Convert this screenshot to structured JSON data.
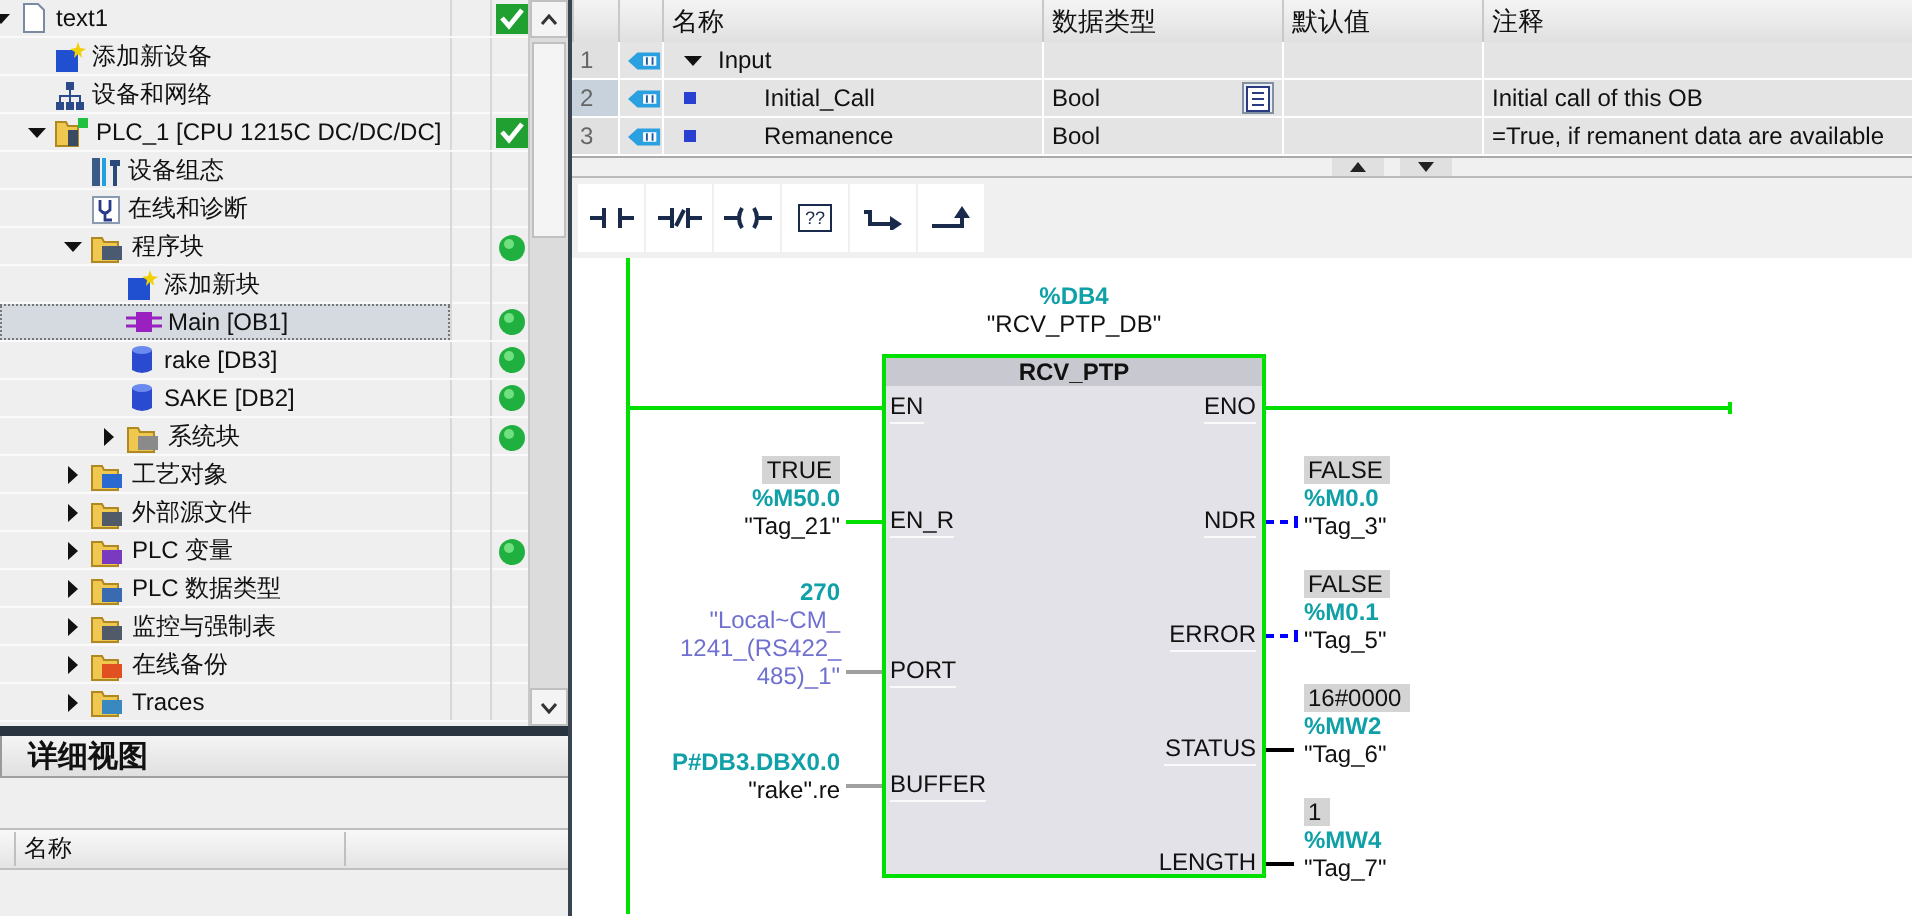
{
  "project_tree": {
    "items": [
      {
        "label": "text1",
        "kind": "project",
        "expanded": true,
        "selected": false,
        "status": {
          "kind": "check"
        },
        "children": [
          {
            "label": "添加新设备",
            "kind": "add-device",
            "selected": false
          },
          {
            "label": "设备和网络",
            "kind": "network",
            "selected": false
          },
          {
            "label": "PLC_1 [CPU 1215C DC/DC/DC]",
            "kind": "plc",
            "expanded": true,
            "selected": false,
            "status": {
              "kind": "check"
            },
            "children": [
              {
                "label": "设备组态",
                "kind": "device-config",
                "selected": false
              },
              {
                "label": "在线和诊断",
                "kind": "diagnostics",
                "selected": false
              },
              {
                "label": "程序块",
                "kind": "block-folder",
                "expanded": true,
                "selected": false,
                "status": {
                  "kind": "dot"
                },
                "children": [
                  {
                    "label": "添加新块",
                    "kind": "add-block",
                    "selected": false
                  },
                  {
                    "label": "Main [OB1]",
                    "kind": "ob",
                    "selected": true,
                    "status": {
                      "kind": "dot"
                    }
                  },
                  {
                    "label": "rake [DB3]",
                    "kind": "db",
                    "selected": false,
                    "status": {
                      "kind": "dot"
                    }
                  },
                  {
                    "label": "SAKE [DB2]",
                    "kind": "db",
                    "selected": false,
                    "status": {
                      "kind": "dot"
                    }
                  },
                  {
                    "label": "系统块",
                    "kind": "system-folder",
                    "expanded": false,
                    "selected": false,
                    "status": {
                      "kind": "dot"
                    }
                  }
                ]
              },
              {
                "label": "工艺对象",
                "kind": "tech-folder",
                "expanded": false,
                "selected": false
              },
              {
                "label": "外部源文件",
                "kind": "source-folder",
                "expanded": false,
                "selected": false
              },
              {
                "label": "PLC 变量",
                "kind": "tag-folder",
                "expanded": false,
                "selected": false,
                "status": {
                  "kind": "dot"
                }
              },
              {
                "label": "PLC 数据类型",
                "kind": "type-folder",
                "expanded": false,
                "selected": false
              },
              {
                "label": "监控与强制表",
                "kind": "watch-folder",
                "expanded": false,
                "selected": false
              },
              {
                "label": "在线备份",
                "kind": "backup-folder",
                "expanded": false,
                "selected": false
              },
              {
                "label": "Traces",
                "kind": "trace-folder",
                "expanded": false,
                "selected": false
              }
            ]
          }
        ]
      }
    ]
  },
  "details_view": {
    "title": "详细视图",
    "columns": [
      "名称"
    ]
  },
  "interface_table": {
    "columns": [
      "名称",
      "数据类型",
      "默认值",
      "注释"
    ],
    "rows": [
      {
        "number": "1",
        "name": "Input",
        "kind": "section",
        "expanded": true,
        "selected": false
      },
      {
        "number": "2",
        "name": "Initial_Call",
        "data_type": "Bool",
        "comment": "Initial call of this OB",
        "kind": "param",
        "selected": true
      },
      {
        "number": "3",
        "name": "Remanence",
        "data_type": "Bool",
        "comment": "=True, if remanent data are available",
        "kind": "param",
        "selected": false
      }
    ]
  },
  "toolbar": [
    {
      "kind": "no-contact"
    },
    {
      "kind": "nc-contact"
    },
    {
      "kind": "coil"
    },
    {
      "kind": "empty-box",
      "label": "??"
    },
    {
      "kind": "open-branch"
    },
    {
      "kind": "close-branch"
    }
  ],
  "network": {
    "instance": {
      "address": "%DB4",
      "name": "\"RCV_PTP_DB\""
    },
    "block": {
      "title": "RCV_PTP",
      "inputs": [
        {
          "pin": "EN",
          "wire": {
            "kind": "powered"
          }
        },
        {
          "pin": "EN_R",
          "wire": {
            "kind": "powered"
          },
          "value": "TRUE",
          "address": "%M50.0",
          "tag": "\"Tag_21\""
        },
        {
          "pin": "PORT",
          "wire": {
            "kind": "parameter"
          },
          "address": "270",
          "tag": "\"Local~CM_ 1241_(RS422_ 485)_1\"",
          "system_constant": true
        },
        {
          "pin": "BUFFER",
          "wire": {
            "kind": "parameter"
          },
          "address": "P#DB3.DBX0.0",
          "tag": "\"rake\".re"
        }
      ],
      "outputs": [
        {
          "pin": "ENO",
          "wire": {
            "kind": "powered"
          }
        },
        {
          "pin": "NDR",
          "wire": {
            "kind": "unpowered"
          },
          "value": "FALSE",
          "address": "%M0.0",
          "tag": "\"Tag_3\""
        },
        {
          "pin": "ERROR",
          "wire": {
            "kind": "unpowered"
          },
          "value": "FALSE",
          "address": "%M0.1",
          "tag": "\"Tag_5\""
        },
        {
          "pin": "STATUS",
          "wire": {
            "kind": "data"
          },
          "value": "16#0000",
          "address": "%MW2",
          "tag": "\"Tag_6\""
        },
        {
          "pin": "LENGTH",
          "wire": {
            "kind": "data"
          },
          "value": "1",
          "address": "%MW4",
          "tag": "\"Tag_7\""
        }
      ]
    }
  }
}
